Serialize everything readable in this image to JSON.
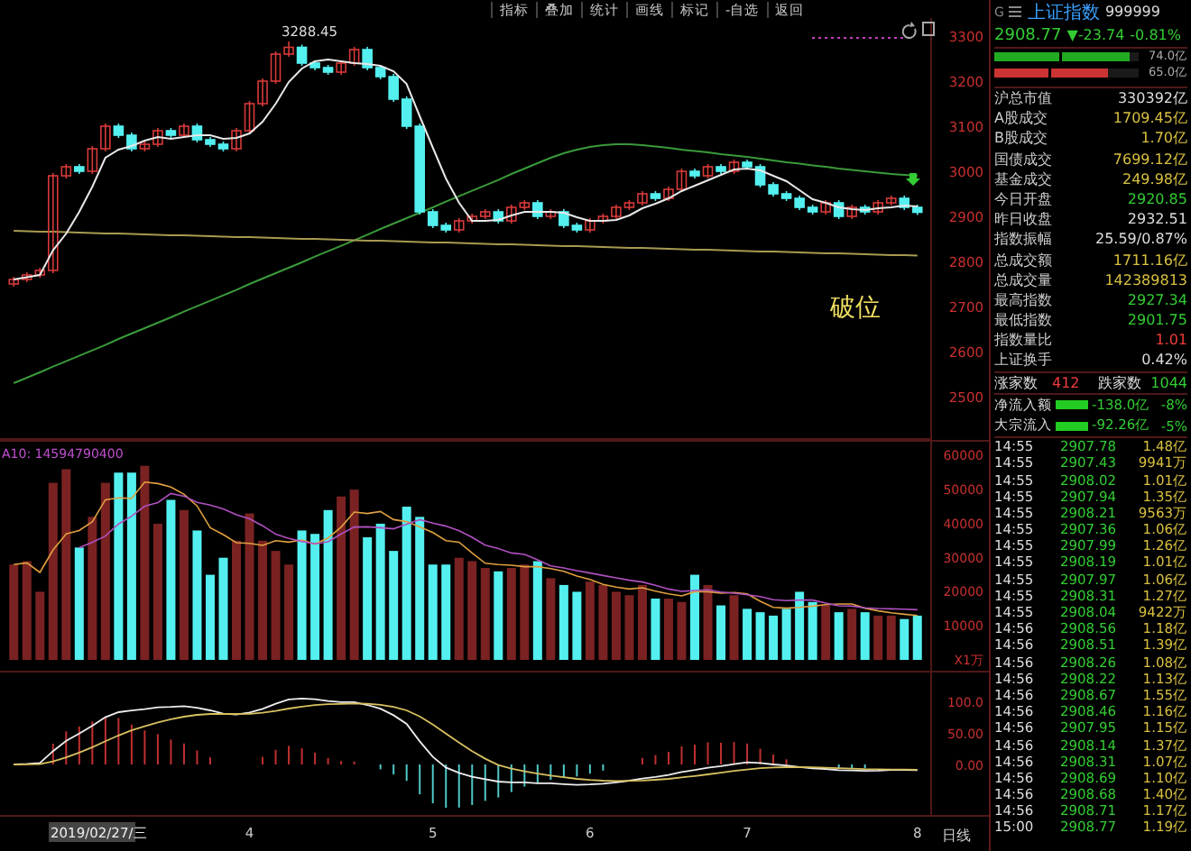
{
  "toolbar": [
    "指标",
    "叠加",
    "统计",
    "画线",
    "标记",
    "-自选",
    "返回"
  ],
  "price_chart": {
    "note": "破位",
    "chart_data": {
      "type": "candlestick",
      "categories": [
        null,
        null,
        null,
        null,
        null,
        null,
        null,
        null,
        null,
        null,
        null,
        null,
        null,
        null,
        null,
        null,
        null,
        null,
        null,
        null,
        null,
        null,
        null,
        null,
        null,
        null,
        null,
        null,
        null,
        null,
        null,
        null,
        null,
        null,
        null,
        null,
        null,
        null,
        null,
        null,
        null,
        null,
        null,
        null,
        null,
        null,
        null,
        null,
        null,
        null,
        null,
        null,
        null,
        null,
        null,
        null,
        null,
        null,
        null,
        null,
        null,
        null,
        null,
        null,
        null,
        null,
        null,
        null,
        null,
        null
      ],
      "ohlc": [
        [
          2750,
          2766,
          2744,
          2760
        ],
        [
          2760,
          2776,
          2754,
          2770
        ],
        [
          2770,
          2786,
          2764,
          2780
        ],
        [
          2780,
          2996,
          2774,
          2990
        ],
        [
          2990,
          3016,
          2984,
          3010
        ],
        [
          3010,
          3016,
          2994,
          3000
        ],
        [
          3000,
          3056,
          2994,
          3050
        ],
        [
          3050,
          3106,
          3044,
          3100
        ],
        [
          3100,
          3106,
          3074,
          3080
        ],
        [
          3080,
          3086,
          3044,
          3050
        ],
        [
          3050,
          3066,
          3044,
          3060
        ],
        [
          3060,
          3096,
          3054,
          3090
        ],
        [
          3090,
          3096,
          3074,
          3080
        ],
        [
          3080,
          3106,
          3074,
          3100
        ],
        [
          3100,
          3106,
          3064,
          3070
        ],
        [
          3070,
          3076,
          3054,
          3060
        ],
        [
          3060,
          3066,
          3044,
          3050
        ],
        [
          3050,
          3096,
          3044,
          3090
        ],
        [
          3090,
          3156,
          3084,
          3150
        ],
        [
          3150,
          3206,
          3144,
          3200
        ],
        [
          3200,
          3266,
          3194,
          3260
        ],
        [
          3260,
          3288,
          3254,
          3275
        ],
        [
          3275,
          3281,
          3234,
          3240
        ],
        [
          3240,
          3246,
          3224,
          3230
        ],
        [
          3230,
          3236,
          3214,
          3220
        ],
        [
          3220,
          3246,
          3214,
          3240
        ],
        [
          3240,
          3276,
          3234,
          3270
        ],
        [
          3270,
          3276,
          3224,
          3230
        ],
        [
          3230,
          3236,
          3204,
          3210
        ],
        [
          3210,
          3216,
          3154,
          3160
        ],
        [
          3160,
          3166,
          3094,
          3100
        ],
        [
          3100,
          3106,
          2904,
          2910
        ],
        [
          2910,
          2916,
          2874,
          2880
        ],
        [
          2880,
          2886,
          2864,
          2870
        ],
        [
          2870,
          2896,
          2864,
          2890
        ],
        [
          2890,
          2906,
          2884,
          2900
        ],
        [
          2900,
          2916,
          2894,
          2910
        ],
        [
          2910,
          2916,
          2884,
          2890
        ],
        [
          2890,
          2926,
          2884,
          2920
        ],
        [
          2920,
          2936,
          2914,
          2930
        ],
        [
          2930,
          2936,
          2894,
          2900
        ],
        [
          2900,
          2916,
          2894,
          2910
        ],
        [
          2910,
          2916,
          2874,
          2880
        ],
        [
          2880,
          2886,
          2864,
          2870
        ],
        [
          2870,
          2896,
          2864,
          2890
        ],
        [
          2890,
          2906,
          2884,
          2900
        ],
        [
          2900,
          2926,
          2894,
          2920
        ],
        [
          2920,
          2936,
          2914,
          2930
        ],
        [
          2930,
          2956,
          2924,
          2950
        ],
        [
          2950,
          2956,
          2934,
          2940
        ],
        [
          2940,
          2966,
          2934,
          2960
        ],
        [
          2960,
          3006,
          2954,
          3000
        ],
        [
          3000,
          3006,
          2984,
          2990
        ],
        [
          2990,
          3016,
          2984,
          3010
        ],
        [
          3010,
          3016,
          2994,
          3000
        ],
        [
          3000,
          3026,
          2994,
          3020
        ],
        [
          3020,
          3026,
          3004,
          3010
        ],
        [
          3010,
          3016,
          2964,
          2970
        ],
        [
          2970,
          2976,
          2944,
          2950
        ],
        [
          2950,
          2956,
          2934,
          2940
        ],
        [
          2940,
          2946,
          2914,
          2920
        ],
        [
          2920,
          2926,
          2904,
          2910
        ],
        [
          2910,
          2936,
          2904,
          2930
        ],
        [
          2930,
          2936,
          2894,
          2900
        ],
        [
          2900,
          2926,
          2894,
          2920
        ],
        [
          2920,
          2926,
          2904,
          2910
        ],
        [
          2910,
          2936,
          2904,
          2930
        ],
        [
          2930,
          2946,
          2924,
          2940
        ],
        [
          2940,
          2946,
          2914,
          2920
        ],
        [
          2920,
          2926,
          2903,
          2909
        ]
      ],
      "series": [
        {
          "type": "line",
          "color": "#e8e8e8",
          "values": [
            2760,
            2765,
            2770,
            2825,
            2862,
            2910,
            2966,
            3030,
            3048,
            3056,
            3068,
            3076,
            3072,
            3076,
            3080,
            3080,
            3072,
            3074,
            3084,
            3110,
            3150,
            3198,
            3228,
            3244,
            3248,
            3244,
            3240,
            3238,
            3234,
            3222,
            3194,
            3122,
            3052,
            2984,
            2930,
            2890,
            2890,
            2892,
            2902,
            2910,
            2910,
            2910,
            2908,
            2898,
            2890,
            2890,
            2892,
            2902,
            2918,
            2928,
            2940,
            2956,
            2968,
            2980,
            2992,
            3004,
            3006,
            3002,
            2990,
            2978,
            2958,
            2938,
            2930,
            2920,
            2916,
            2914,
            2918,
            2920,
            2924,
            2922
          ]
        },
        {
          "type": "line",
          "color": "#3a9a3a",
          "values": [
            2530,
            2542,
            2554,
            2567,
            2579,
            2591,
            2603,
            2615,
            2628,
            2640,
            2652,
            2664,
            2676,
            2689,
            2701,
            2713,
            2725,
            2737,
            2750,
            2762,
            2774,
            2786,
            2798,
            2811,
            2823,
            2835,
            2847,
            2859,
            2872,
            2884,
            2896,
            2908,
            2920,
            2933,
            2945,
            2957,
            2969,
            2981,
            2994,
            3006,
            3018,
            3030,
            3040,
            3048,
            3054,
            3058,
            3060,
            3060,
            3058,
            3055,
            3052,
            3048,
            3045,
            3042,
            3038,
            3035,
            3032,
            3028,
            3024,
            3020,
            3017,
            3013,
            3010,
            3006,
            3003,
            3000,
            2997,
            2994,
            2992,
            2990
          ]
        },
        {
          "type": "line",
          "color": "#a89a50",
          "values": [
            2868,
            2867,
            2866,
            2866,
            2865,
            2864,
            2863,
            2862,
            2862,
            2861,
            2860,
            2859,
            2858,
            2858,
            2857,
            2856,
            2855,
            2854,
            2854,
            2853,
            2852,
            2851,
            2850,
            2850,
            2849,
            2848,
            2847,
            2846,
            2846,
            2845,
            2844,
            2843,
            2842,
            2842,
            2841,
            2840,
            2839,
            2838,
            2838,
            2837,
            2836,
            2835,
            2834,
            2834,
            2833,
            2832,
            2831,
            2830,
            2830,
            2829,
            2828,
            2827,
            2826,
            2826,
            2825,
            2824,
            2823,
            2822,
            2822,
            2821,
            2820,
            2819,
            2818,
            2818,
            2817,
            2816,
            2815,
            2814,
            2814,
            2813
          ]
        }
      ],
      "ylim": [
        2404,
        3340
      ],
      "yticks": [
        {
          "value": 3300,
          "label": "3300"
        },
        {
          "value": 3200,
          "label": "3200"
        },
        {
          "value": 3100,
          "label": "3100"
        },
        {
          "value": 3000,
          "label": "3000"
        },
        {
          "value": 2900,
          "label": "2900"
        },
        {
          "value": 2800,
          "label": "2800"
        },
        {
          "value": 2700,
          "label": "2700"
        },
        {
          "value": 2600,
          "label": "2600"
        },
        {
          "value": 2500,
          "label": "2500"
        }
      ],
      "annotations": [
        "3288.45"
      ]
    }
  },
  "volume_chart": {
    "indicator_label": "A10: 14594790400",
    "chart_data": {
      "type": "bar",
      "categories": [
        null,
        null,
        null,
        null,
        null,
        null,
        null,
        null,
        null,
        null,
        null,
        null,
        null,
        null,
        null,
        null,
        null,
        null,
        null,
        null,
        null,
        null,
        null,
        null,
        null,
        null,
        null,
        null,
        null,
        null,
        null,
        null,
        null,
        null,
        null,
        null,
        null,
        null,
        null,
        null,
        null,
        null,
        null,
        null,
        null,
        null,
        null,
        null,
        null,
        null,
        null,
        null,
        null,
        null,
        null,
        null,
        null,
        null,
        null,
        null,
        null,
        null,
        null,
        null,
        null,
        null,
        null,
        null,
        null,
        null
      ],
      "series": [
        {
          "color": "#7a2222",
          "values": [
            28000,
            29000,
            20000,
            52000,
            56000,
            null,
            42000,
            52000,
            null,
            null,
            57000,
            40000,
            null,
            44000,
            null,
            null,
            null,
            35000,
            43000,
            35000,
            32000,
            28000,
            null,
            null,
            null,
            48000,
            50000,
            null,
            null,
            null,
            null,
            null,
            null,
            null,
            30000,
            29000,
            27000,
            null,
            27000,
            28000,
            null,
            24000,
            null,
            null,
            23000,
            22000,
            20000,
            19000,
            22000,
            null,
            18000,
            17000,
            null,
            22000,
            null,
            19000,
            null,
            null,
            null,
            null,
            null,
            null,
            16000,
            null,
            15000,
            null,
            13000,
            13000,
            null,
            null
          ]
        },
        {
          "color": "#54f0f0",
          "values": [
            null,
            null,
            null,
            null,
            null,
            33000,
            null,
            null,
            55000,
            55000,
            null,
            null,
            47000,
            null,
            38000,
            25000,
            30000,
            null,
            null,
            null,
            null,
            null,
            38000,
            37000,
            44000,
            null,
            null,
            36000,
            40000,
            32000,
            45000,
            42000,
            28000,
            28000,
            null,
            null,
            null,
            26000,
            null,
            null,
            29000,
            null,
            22000,
            20000,
            null,
            null,
            null,
            null,
            null,
            18000,
            null,
            null,
            25000,
            null,
            16000,
            null,
            15000,
            14000,
            13000,
            15000,
            20000,
            17000,
            null,
            14000,
            null,
            14000,
            null,
            null,
            12000,
            13000
          ]
        },
        {
          "type": "line",
          "color": "#e0a040",
          "values": [
            28000,
            28500,
            25700,
            32300,
            37000,
            38000,
            40600,
            47000,
            47600,
            47400,
            52200,
            51800,
            50800,
            48600,
            45200,
            38800,
            36800,
            34400,
            34200,
            33600,
            35000,
            34600,
            35200,
            34000,
            35800,
            39000,
            43400,
            43000,
            43600,
            41200,
            40600,
            39000,
            37400,
            35000,
            34600,
            31400,
            28400,
            28000,
            27800,
            27400,
            27400,
            26800,
            26000,
            24600,
            23600,
            22200,
            21400,
            20800,
            21200,
            20200,
            19400,
            18800,
            20000,
            20000,
            19600,
            19800,
            19400,
            17200,
            15400,
            15200,
            15400,
            15800,
            16200,
            16400,
            16400,
            15200,
            14400,
            13800,
            13400,
            13000
          ]
        },
        {
          "type": "line",
          "color": "#b050c0",
          "values": [
            null,
            null,
            null,
            null,
            null,
            33000,
            34600,
            36400,
            39900,
            42200,
            45100,
            46200,
            48900,
            48100,
            46300,
            45500,
            44300,
            42600,
            41400,
            39400,
            36900,
            35700,
            34800,
            34100,
            34700,
            37000,
            39000,
            39100,
            38800,
            38500,
            39800,
            41200,
            40200,
            39300,
            37900,
            36000,
            33700,
            32700,
            31400,
            31000,
            29400,
            27600,
            27000,
            26200,
            25500,
            24800,
            24100,
            23400,
            22900,
            21900,
            20800,
            20100,
            20400,
            20600,
            19900,
            19600,
            19100,
            18600,
            17700,
            17400,
            17600,
            17600,
            16700,
            15900,
            15800,
            15300,
            15100,
            15000,
            14900,
            14700
          ]
        }
      ],
      "ylim": [
        0,
        64600
      ],
      "yticks": [
        {
          "value": 60000,
          "label": "60000"
        },
        {
          "value": 50000,
          "label": "50000"
        },
        {
          "value": 40000,
          "label": "40000"
        },
        {
          "value": 30000,
          "label": "30000"
        },
        {
          "value": 20000,
          "label": "20000"
        },
        {
          "value": 10000,
          "label": "10000"
        },
        {
          "value": 0,
          "label": "X1万"
        }
      ]
    }
  },
  "macd": {
    "axis_labels": [
      "100.0",
      "50.00",
      "0.00"
    ]
  },
  "date_axis": {
    "cursor": "2019/02/27/三",
    "labels": [
      "4",
      "5",
      "6",
      "7",
      "8"
    ],
    "period": "日线"
  },
  "quote": {
    "prefix": "G",
    "name": "上证指数",
    "code": "999999",
    "price": "2908.77",
    "change": "▼-23.74",
    "percent": "-0.81%"
  },
  "order_bars": [
    {
      "color": "#22aa22",
      "level": 0.94,
      "value": "74.0亿"
    },
    {
      "color": "#cc3333",
      "level": 0.79,
      "value": "65.0亿"
    }
  ],
  "stats": [
    {
      "label": "沪总市值",
      "value": "330392亿",
      "color": "#dddddd"
    },
    {
      "label": "A股成交",
      "value": "1709.45亿",
      "color": "#d8c040"
    },
    {
      "label": "B股成交",
      "value": "1.70亿",
      "color": "#d8c040"
    },
    {
      "label": "国债成交",
      "value": "7699.12亿",
      "color": "#d8c040"
    },
    {
      "label": "基金成交",
      "value": "249.98亿",
      "color": "#d8c040"
    },
    {
      "label": "今日开盘",
      "value": "2920.85",
      "color": "#33cc33"
    },
    {
      "label": "昨日收盘",
      "value": "2932.51",
      "color": "#dddddd"
    },
    {
      "label": "指数振幅",
      "value": "25.59/0.87%",
      "color": "#dddddd"
    },
    {
      "label": "总成交额",
      "value": "1711.16亿",
      "color": "#d8c040"
    },
    {
      "label": "总成交量",
      "value": "142389813",
      "color": "#d8c040"
    },
    {
      "label": "最高指数",
      "value": "2927.34",
      "color": "#33cc33"
    },
    {
      "label": "最低指数",
      "value": "2901.75",
      "color": "#33cc33"
    },
    {
      "label": "指数量比",
      "value": "1.01",
      "color": "#f03c3c"
    },
    {
      "label": "上证换手",
      "value": "0.42%",
      "color": "#dddddd"
    }
  ],
  "breadth": {
    "up_label": "涨家数",
    "up_count": "412",
    "down_label": "跌家数",
    "down_count": "1044"
  },
  "flows": [
    {
      "label": "净流入额",
      "level": 1,
      "value": "-138.0亿",
      "percent": "-8%"
    },
    {
      "label": "大宗流入",
      "level": 1,
      "value": "-92.26亿",
      "percent": "-5%"
    }
  ],
  "ticks": [
    {
      "time": "14:55",
      "price": "2907.78",
      "volume": "1.48亿"
    },
    {
      "time": "14:55",
      "price": "2907.43",
      "volume": "9941万"
    },
    {
      "time": "14:55",
      "price": "2908.02",
      "volume": "1.01亿"
    },
    {
      "time": "14:55",
      "price": "2907.94",
      "volume": "1.35亿"
    },
    {
      "time": "14:55",
      "price": "2908.21",
      "volume": "9563万"
    },
    {
      "time": "14:55",
      "price": "2907.36",
      "volume": "1.06亿"
    },
    {
      "time": "14:55",
      "price": "2907.99",
      "volume": "1.26亿"
    },
    {
      "time": "14:55",
      "price": "2908.19",
      "volume": "1.01亿"
    },
    {
      "time": "14:55",
      "price": "2907.97",
      "volume": "1.06亿"
    },
    {
      "time": "14:55",
      "price": "2908.31",
      "volume": "1.27亿"
    },
    {
      "time": "14:55",
      "price": "2908.04",
      "volume": "9422万"
    },
    {
      "time": "14:56",
      "price": "2908.56",
      "volume": "1.18亿"
    },
    {
      "time": "14:56",
      "price": "2908.51",
      "volume": "1.39亿"
    },
    {
      "time": "14:56",
      "price": "2908.26",
      "volume": "1.08亿"
    },
    {
      "time": "14:56",
      "price": "2908.22",
      "volume": "1.13亿"
    },
    {
      "time": "14:56",
      "price": "2908.67",
      "volume": "1.55亿"
    },
    {
      "time": "14:56",
      "price": "2908.46",
      "volume": "1.16亿"
    },
    {
      "time": "14:56",
      "price": "2907.95",
      "volume": "1.15亿"
    },
    {
      "time": "14:56",
      "price": "2908.14",
      "volume": "1.37亿"
    },
    {
      "time": "14:56",
      "price": "2908.31",
      "volume": "1.07亿"
    },
    {
      "time": "14:56",
      "price": "2908.69",
      "volume": "1.10亿"
    },
    {
      "time": "14:56",
      "price": "2908.68",
      "volume": "1.40亿"
    },
    {
      "time": "14:56",
      "price": "2908.71",
      "volume": "1.17亿"
    },
    {
      "time": "15:00",
      "price": "2908.77",
      "volume": "1.19亿"
    }
  ]
}
